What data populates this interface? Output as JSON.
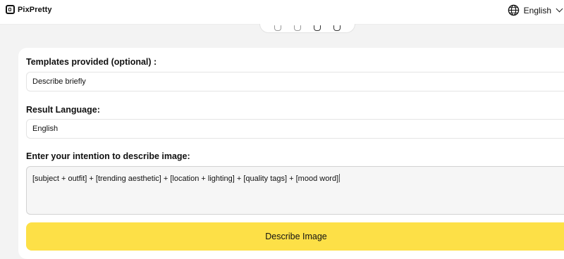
{
  "app": {
    "name": "PixPretty"
  },
  "header": {
    "language": "English"
  },
  "form": {
    "template_label": "Templates provided (optional) :",
    "template_value": "Describe briefly",
    "result_language_label": "Result Language:",
    "result_language_value": "English",
    "intention_label": "Enter your intention to describe image:",
    "intention_value": "[subject + outfit] + [trending aesthetic] + [location + lighting] + [quality tags] + [mood word]",
    "submit_label": "Describe Image"
  },
  "colors": {
    "submit_button": "#fde047",
    "background": "#f3f3f3"
  },
  "icons": {
    "logo": "pixpretty-logo-icon",
    "language": "globe-icon",
    "dropdown": "chevron-down-icon"
  }
}
